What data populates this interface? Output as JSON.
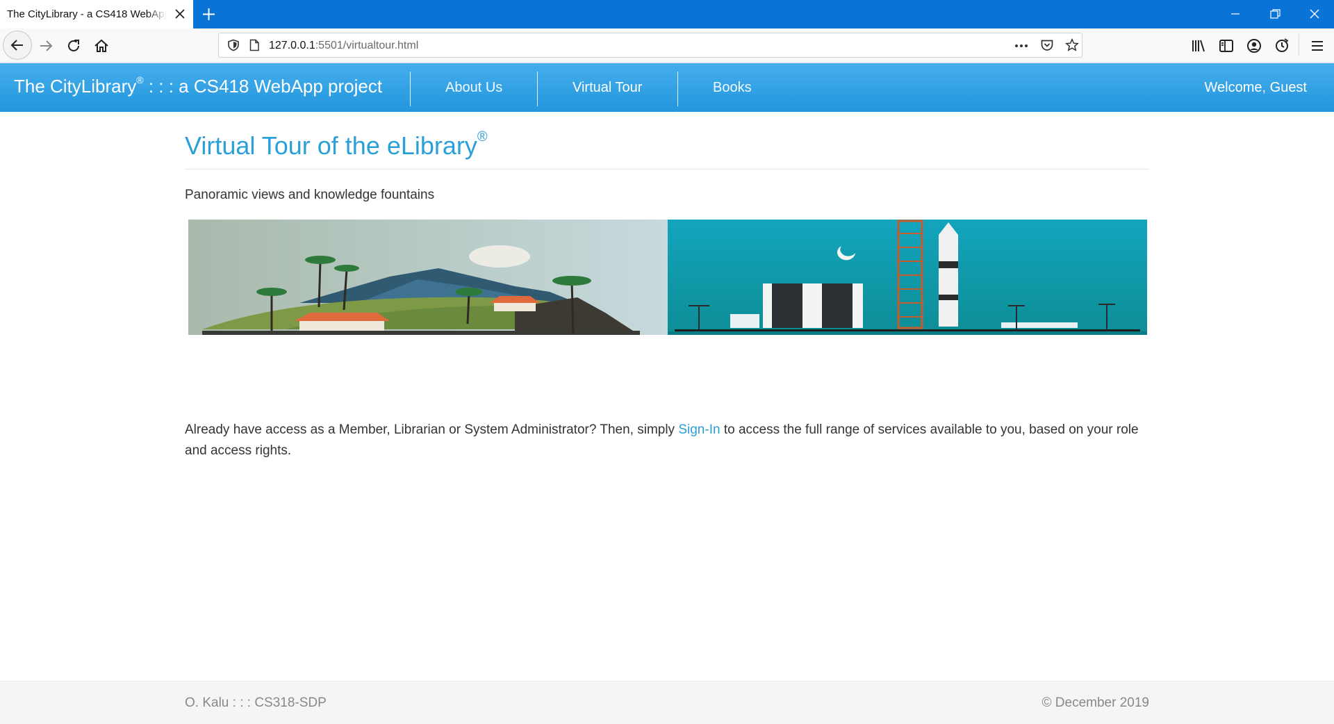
{
  "browser": {
    "tab_title": "The CityLibrary - a CS418 WebApp project",
    "url_host": "127.0.0.1",
    "url_rest": ":5501/virtualtour.html",
    "icons": {
      "back": "back-arrow-icon",
      "forward": "forward-arrow-icon",
      "reload": "reload-icon",
      "home": "home-icon",
      "shield": "shield-icon",
      "page": "page-icon",
      "more": "more-dots-icon",
      "pocket": "pocket-icon",
      "bookmark": "star-icon",
      "library": "library-icon",
      "sidebar": "sidebar-icon",
      "account": "account-icon",
      "sync": "sync-icon",
      "menu": "hamburger-menu-icon"
    },
    "colors": {
      "tabstrip": "#0a74d6",
      "toolbar": "#f9f9fb"
    }
  },
  "navbar": {
    "brand_name": "The CityLibrary",
    "brand_mark": "®",
    "brand_suffix": " : : : a CS418 WebApp project",
    "links": [
      {
        "label": "About Us"
      },
      {
        "label": "Virtual Tour"
      },
      {
        "label": "Books"
      }
    ],
    "welcome": "Welcome, Guest",
    "colors": {
      "top": "#46aeec",
      "bottom": "#2296dd"
    }
  },
  "main": {
    "title": "Virtual Tour of the eLibrary",
    "title_mark": "®",
    "subtitle": "Panoramic views and knowledge fountains",
    "access_before": "Already have access as a Member, Librarian or System Administrator? Then, simply ",
    "signin_label": "Sign-In",
    "access_after": " to access the full range of services available to you, based on your role and access rights.",
    "accent_color": "#2a9fd8"
  },
  "footer": {
    "left": "O. Kalu : : : CS318-SDP",
    "right": "© December 2019"
  }
}
